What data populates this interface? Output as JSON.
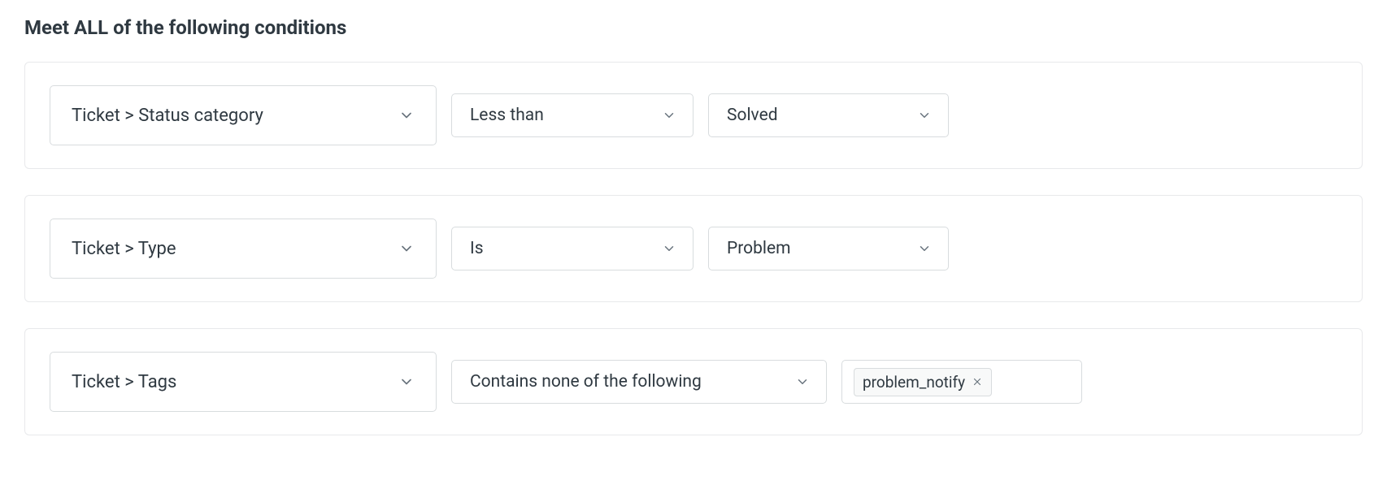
{
  "section": {
    "title": "Meet ALL of the following conditions"
  },
  "conditions": [
    {
      "field": "Ticket > Status category",
      "operator": "Less than",
      "value": "Solved"
    },
    {
      "field": "Ticket > Type",
      "operator": "Is",
      "value": "Problem"
    },
    {
      "field": "Ticket > Tags",
      "operator": "Contains none of the following",
      "tags": [
        "problem_notify"
      ]
    }
  ]
}
